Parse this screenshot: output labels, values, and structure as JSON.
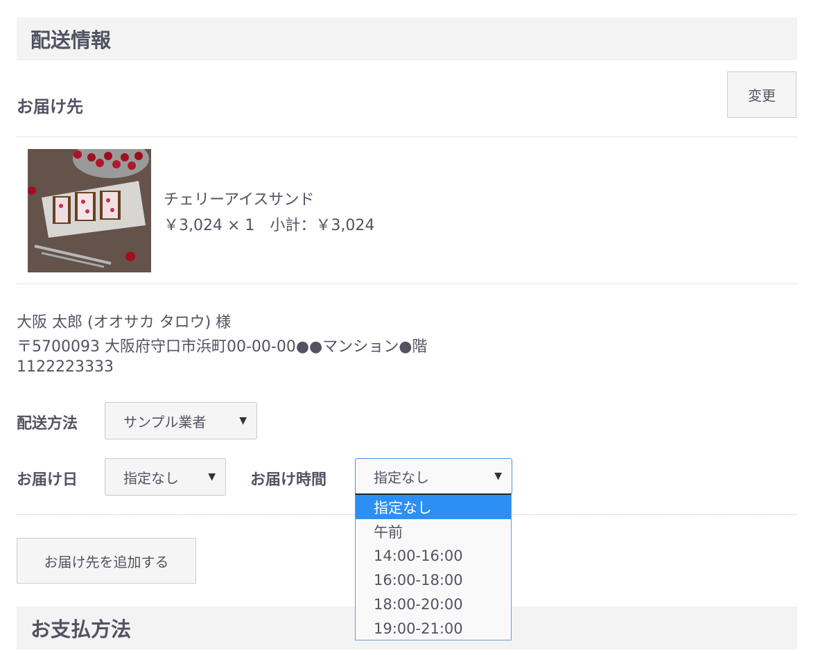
{
  "shipping": {
    "header": "配送情報",
    "destination_label": "お届け先",
    "change_button": "変更",
    "product": {
      "name": "チェリーアイスサンド",
      "price_line": "￥3,024 × 1　小計：￥3,024"
    },
    "address": {
      "name_line": "大阪 太郎 (オオサカ タロウ) 様",
      "address_line": "〒5700093 大阪府守口市浜町00-00-00●●マンション●階",
      "phone": "1122223333"
    },
    "method": {
      "label": "配送方法",
      "value": "サンプル業者"
    },
    "date": {
      "label": "お届け日",
      "value": "指定なし"
    },
    "time": {
      "label": "お届け時間",
      "value": "指定なし",
      "options": [
        "指定なし",
        "午前",
        "14:00-16:00",
        "16:00-18:00",
        "18:00-20:00",
        "19:00-21:00"
      ],
      "selected_option": "指定なし"
    },
    "add_destination_button": "お届け先を追加する"
  },
  "payment": {
    "header": "お支払方法"
  }
}
